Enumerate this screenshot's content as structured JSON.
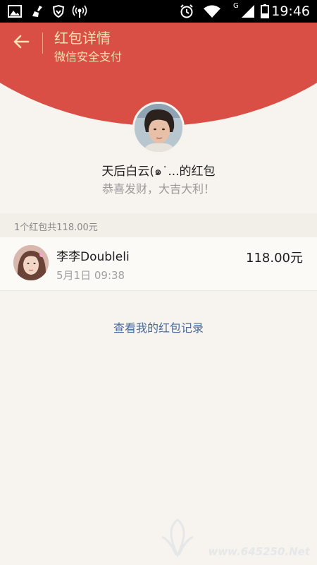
{
  "status_bar": {
    "time": "19:46",
    "network_label": "G",
    "icons": [
      "gallery-icon",
      "broom-icon",
      "shield-icon",
      "hotspot-icon",
      "alarm-icon",
      "wifi-icon",
      "signal-icon",
      "battery-icon"
    ]
  },
  "header": {
    "title": "红包详情",
    "subtitle": "微信安全支付",
    "back_icon": "back-arrow-icon",
    "background_color": "#d94f45",
    "text_color": "#fbe2b4"
  },
  "sender": {
    "name": "天后白云(๑˙...的红包",
    "blessing": "恭喜发财，大吉大利！"
  },
  "summary": {
    "text": "1个红包共118.00元"
  },
  "records": [
    {
      "name": "李李Doubleli",
      "time": "5月1日  09:38",
      "amount": "118.00元"
    }
  ],
  "history_link": "查看我的红包记录",
  "watermark": {
    "text": "www.645250.Net"
  }
}
